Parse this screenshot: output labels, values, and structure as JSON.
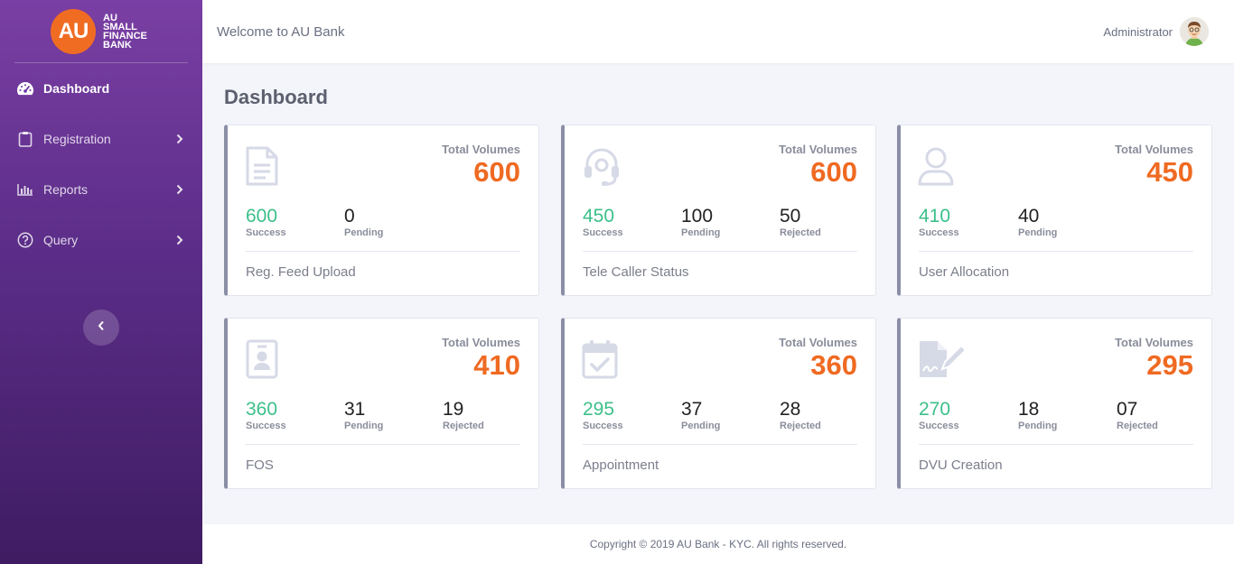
{
  "brand": {
    "logo_text": "AU",
    "name_lines": [
      "AU",
      "SMALL",
      "FINANCE",
      "BANK"
    ]
  },
  "sidebar": {
    "items": [
      {
        "label": "Dashboard",
        "icon": "speedometer-icon",
        "active": true
      },
      {
        "label": "Registration",
        "icon": "clipboard-icon"
      },
      {
        "label": "Reports",
        "icon": "bar-chart-icon"
      },
      {
        "label": "Query",
        "icon": "question-circle-icon"
      }
    ]
  },
  "header": {
    "welcome": "Welcome to AU Bank",
    "user": "Administrator"
  },
  "main": {
    "title": "Dashboard",
    "cards": [
      {
        "name": "Reg. Feed Upload",
        "icon": "document-icon",
        "total_label": "Total Volumes",
        "total": "600",
        "stats": [
          {
            "value": "600",
            "label": "Success"
          },
          {
            "value": "0",
            "label": "Pending"
          }
        ]
      },
      {
        "name": "Tele Caller Status",
        "icon": "headset-icon",
        "total_label": "Total Volumes",
        "total": "600",
        "stats": [
          {
            "value": "450",
            "label": "Success"
          },
          {
            "value": "100",
            "label": "Pending"
          },
          {
            "value": "50",
            "label": "Rejected"
          }
        ]
      },
      {
        "name": "User Allocation",
        "icon": "user-icon",
        "total_label": "Total Volumes",
        "total": "450",
        "stats": [
          {
            "value": "410",
            "label": "Success"
          },
          {
            "value": "40",
            "label": "Pending"
          }
        ]
      },
      {
        "name": "FOS",
        "icon": "id-badge-icon",
        "total_label": "Total Volumes",
        "total": "410",
        "stats": [
          {
            "value": "360",
            "label": "Success"
          },
          {
            "value": "31",
            "label": "Pending"
          },
          {
            "value": "19",
            "label": "Rejected"
          }
        ]
      },
      {
        "name": "Appointment",
        "icon": "calendar-check-icon",
        "total_label": "Total Volumes",
        "total": "360",
        "stats": [
          {
            "value": "295",
            "label": "Success"
          },
          {
            "value": "37",
            "label": "Pending"
          },
          {
            "value": "28",
            "label": "Rejected"
          }
        ]
      },
      {
        "name": "DVU Creation",
        "icon": "file-signature-icon",
        "total_label": "Total Volumes",
        "total": "295",
        "stats": [
          {
            "value": "270",
            "label": "Success"
          },
          {
            "value": "18",
            "label": "Pending"
          },
          {
            "value": "07",
            "label": "Rejected"
          }
        ]
      }
    ]
  },
  "footer": {
    "text": "Copyright © 2019 AU Bank - KYC. All rights reserved."
  },
  "colors": {
    "accent": "#ef6a22",
    "success": "#3cbf89",
    "sidebar_top": "#7a3fa4",
    "sidebar_bottom": "#3f1c62"
  }
}
